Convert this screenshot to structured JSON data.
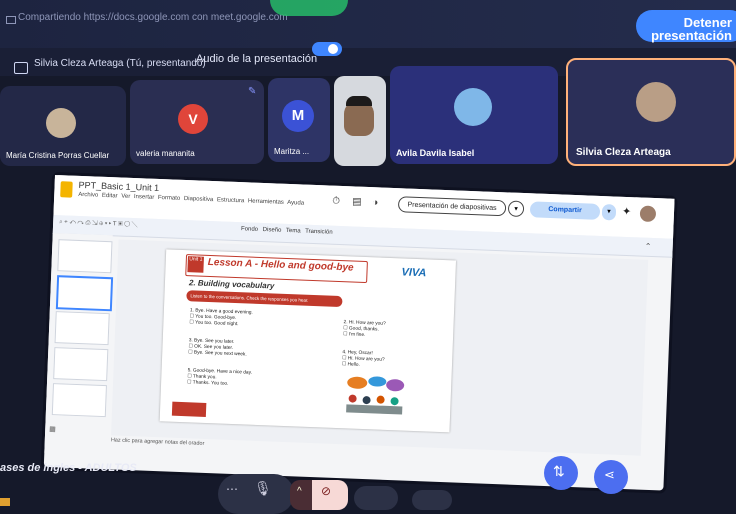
{
  "share": {
    "text": "Compartiendo https://docs.google.com con meet.google.com",
    "stop_label": "Detener presentación"
  },
  "presenter": {
    "name": "Silvia Cleza Arteaga (Tú, presentando)",
    "audio_label": "Audio de la presentación"
  },
  "participants": [
    {
      "name": "María Cristina Porras Cuellar",
      "initial": ""
    },
    {
      "name": "valeria mananita",
      "initial": "V"
    },
    {
      "name": "Maritza ...",
      "initial": "M"
    },
    {
      "name": "",
      "initial": ""
    },
    {
      "name": "Avila Davila Isabel",
      "initial": ""
    },
    {
      "name": "Silvia Cleza Arteaga",
      "initial": ""
    }
  ],
  "slides_app": {
    "doc_title": "PPT_Basic 1_Unit 1",
    "menu": "Archivo  Editar  Ver  Insertar  Formato  Diapositiva  Estructura  Herramientas  Ayuda",
    "present_button": "Presentación de diapositivas",
    "share_button": "Compartir",
    "toolbar": "Fondo   Diseño   Tema   Transición",
    "notes_placeholder": "Haz clic para agregar notas del orador"
  },
  "slide": {
    "unit": "Unit 1",
    "lesson_title": "Lesson A - Hello and good-bye",
    "subtitle": "2. Building vocabulary",
    "instruction": "Listen to the conversations. Check the responses you hear.",
    "brand": "VIVA",
    "exercises": [
      {
        "q": "1. Bye. Have a good evening.",
        "a": [
          "You too. Good-bye.",
          "You too. Good night."
        ]
      },
      {
        "q": "2. Hi. How are you?",
        "a": [
          "Good, thanks.",
          "I'm fine."
        ]
      },
      {
        "q": "3. Bye. See you later.",
        "a": [
          "OK. See you later.",
          "Bye. See you next week."
        ]
      },
      {
        "q": "4. Hey, Oscar!",
        "a": [
          "Hi. How are you?",
          "Hello."
        ]
      },
      {
        "q": "5. Good-bye. Have a nice day.",
        "a": [
          "Thank you.",
          "Thanks. You too."
        ]
      }
    ]
  },
  "meeting": {
    "course_name": "ases de ingles - ADULTOS"
  },
  "colors": {
    "accent": "#3f86ff",
    "lesson_red": "#c0392b",
    "background": "#15192a"
  }
}
